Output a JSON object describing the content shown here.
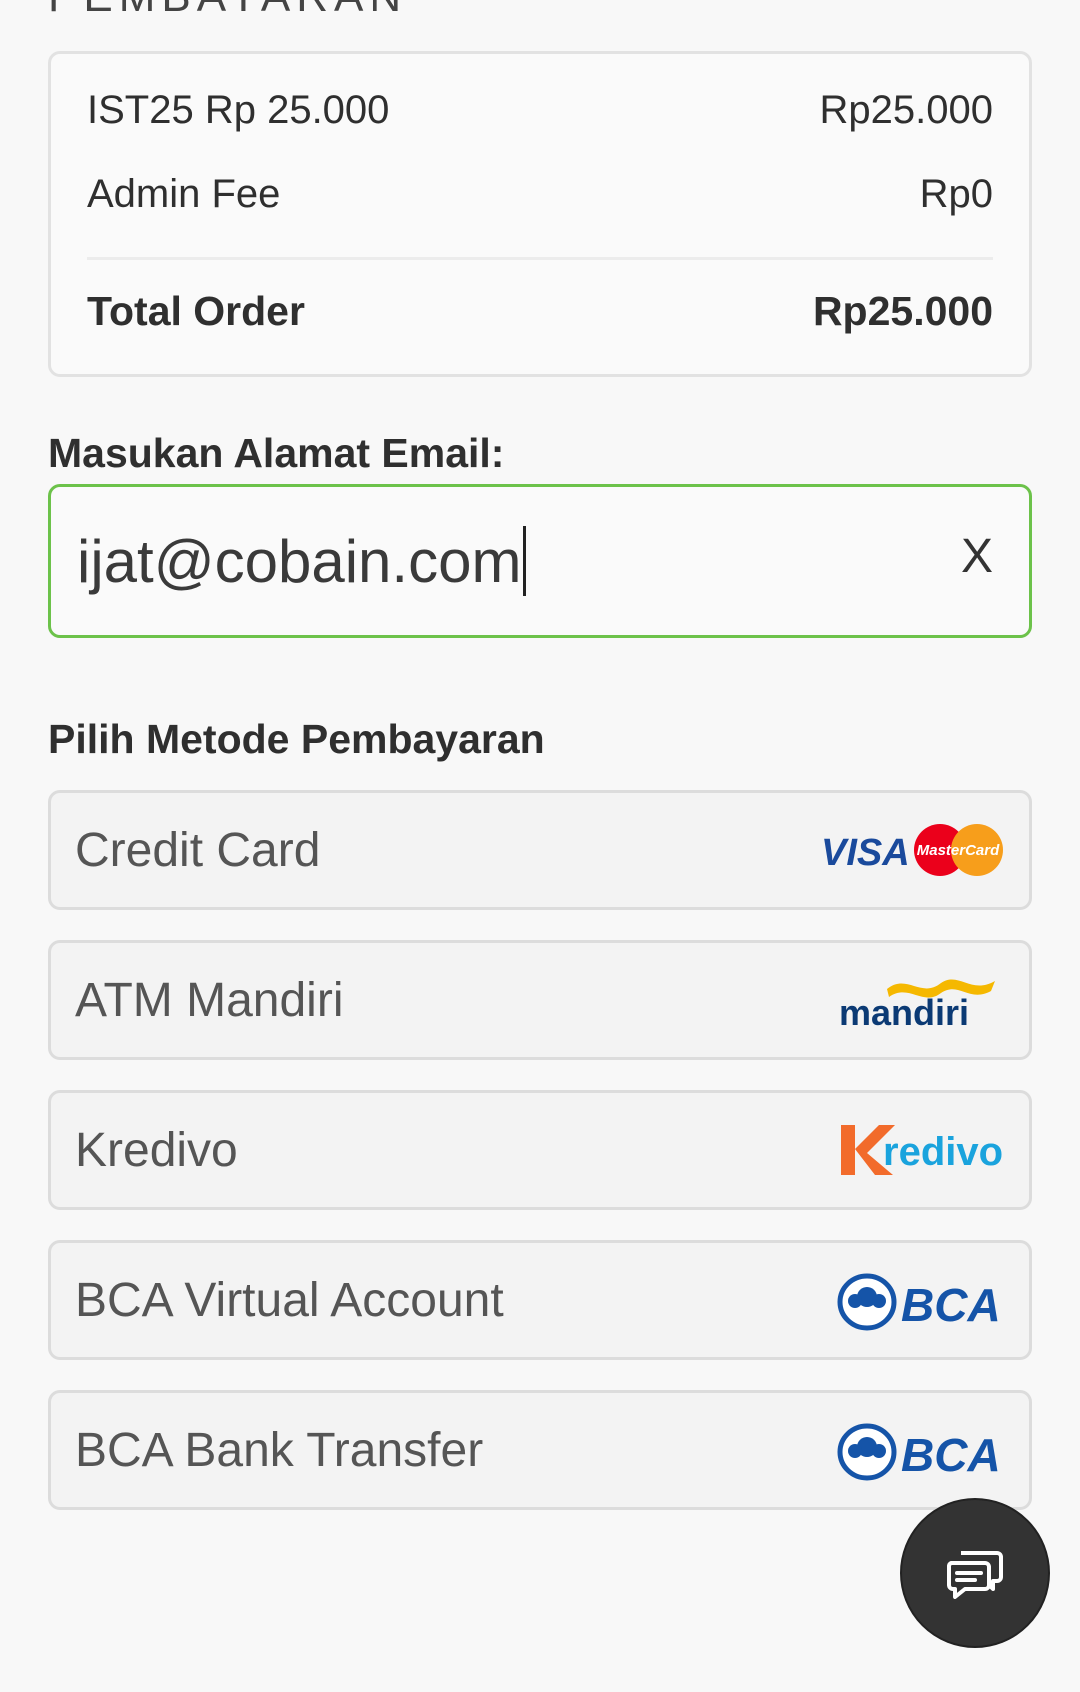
{
  "page": {
    "heading": "PEMBAYARAN"
  },
  "summary": {
    "item_label": "IST25 Rp 25.000",
    "item_price": "Rp25.000",
    "admin_fee_label": "Admin Fee",
    "admin_fee_value": "Rp0",
    "total_label": "Total Order",
    "total_value": "Rp25.000"
  },
  "email": {
    "label": "Masukan Alamat Email:",
    "value": "ijat@cobain.com",
    "clear_label": "X",
    "focus_color": "#6cc24a"
  },
  "payment": {
    "title": "Pilih Metode Pembayaran",
    "methods": [
      {
        "label": "Credit Card",
        "logo": "visa-mastercard-logo",
        "logo_text": [
          "VISA",
          "MasterCard"
        ]
      },
      {
        "label": "ATM Mandiri",
        "logo": "mandiri-logo",
        "logo_text": [
          "mandiri"
        ]
      },
      {
        "label": "Kredivo",
        "logo": "kredivo-logo",
        "logo_text": [
          "Kredivo"
        ]
      },
      {
        "label": "BCA Virtual Account",
        "logo": "bca-logo",
        "logo_text": [
          "BCA"
        ]
      },
      {
        "label": "BCA Bank Transfer",
        "logo": "bca-logo",
        "logo_text": [
          "BCA"
        ]
      }
    ]
  },
  "chat": {
    "icon": "chat-icon"
  },
  "colors": {
    "visa_blue": "#1a4a9c",
    "mastercard_red": "#eb001b",
    "mastercard_orange": "#f79e1b",
    "mandiri_navy": "#0b3a74",
    "mandiri_gold": "#f5b800",
    "kredivo_orange": "#f26b2b",
    "kredivo_blue": "#1aa3dd",
    "bca_blue": "#1554a8"
  }
}
